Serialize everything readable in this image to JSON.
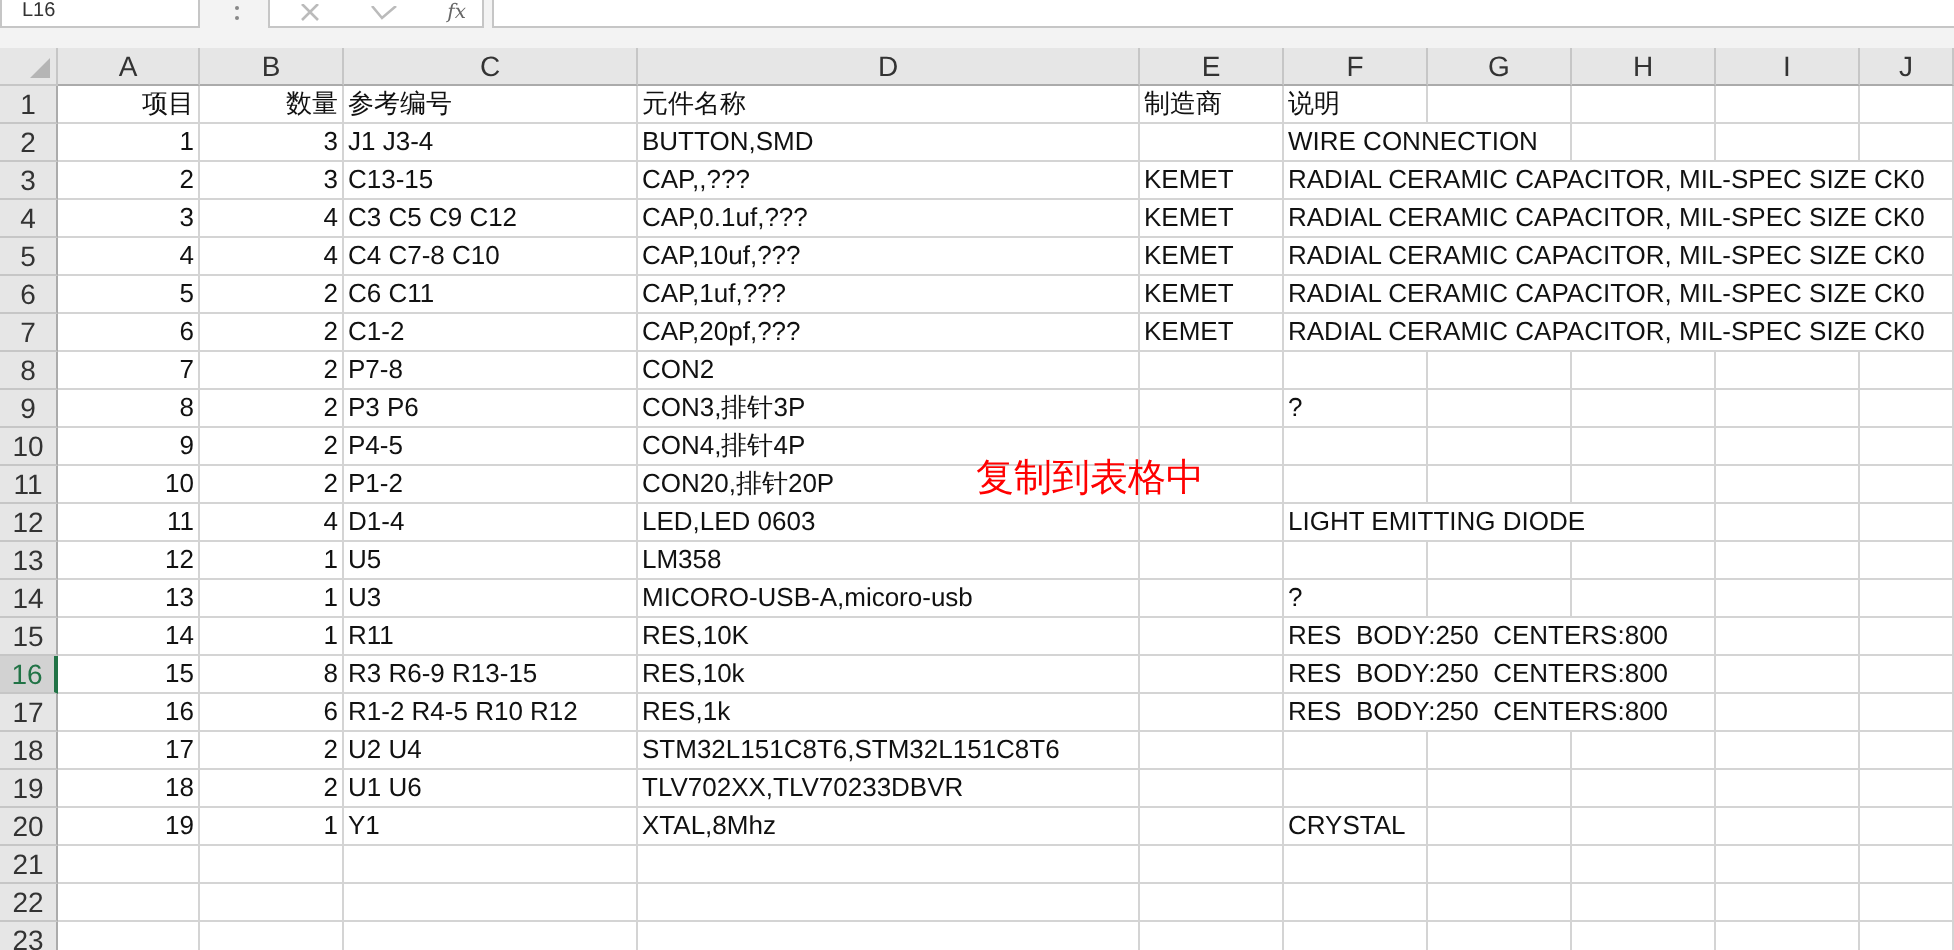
{
  "name_box": "L16",
  "formula_label": "fx",
  "columns": [
    "A",
    "B",
    "C",
    "D",
    "E",
    "F",
    "G",
    "H",
    "I",
    "J"
  ],
  "rows": [
    {
      "number": "1",
      "selected": false,
      "cells": {
        "A": "项目",
        "B": "数量",
        "C": "参考编号",
        "D": "元件名称",
        "E": "制造商",
        "F": "说明"
      }
    },
    {
      "number": "2",
      "selected": false,
      "cells": {
        "A": "1",
        "B": "3",
        "C": "J1 J3-4",
        "D": "BUTTON,SMD",
        "F": "WIRE CONNECTION"
      }
    },
    {
      "number": "3",
      "selected": false,
      "cells": {
        "A": "2",
        "B": "3",
        "C": "C13-15",
        "D": "CAP,,???",
        "E": "KEMET",
        "F": "RADIAL CERAMIC CAPACITOR, MIL-SPEC SIZE CK0"
      }
    },
    {
      "number": "4",
      "selected": false,
      "cells": {
        "A": "3",
        "B": "4",
        "C": "C3 C5 C9 C12",
        "D": "CAP,0.1uf,???",
        "E": "KEMET",
        "F": "RADIAL CERAMIC CAPACITOR, MIL-SPEC SIZE CK0"
      }
    },
    {
      "number": "5",
      "selected": false,
      "cells": {
        "A": "4",
        "B": "4",
        "C": "C4 C7-8 C10",
        "D": "CAP,10uf,???",
        "E": "KEMET",
        "F": "RADIAL CERAMIC CAPACITOR, MIL-SPEC SIZE CK0"
      }
    },
    {
      "number": "6",
      "selected": false,
      "cells": {
        "A": "5",
        "B": "2",
        "C": "C6 C11",
        "D": "CAP,1uf,???",
        "E": "KEMET",
        "F": "RADIAL CERAMIC CAPACITOR, MIL-SPEC SIZE CK0"
      }
    },
    {
      "number": "7",
      "selected": false,
      "cells": {
        "A": "6",
        "B": "2",
        "C": "C1-2",
        "D": "CAP,20pf,???",
        "E": "KEMET",
        "F": "RADIAL CERAMIC CAPACITOR, MIL-SPEC SIZE CK0"
      }
    },
    {
      "number": "8",
      "selected": false,
      "cells": {
        "A": "7",
        "B": "2",
        "C": "P7-8",
        "D": "CON2"
      }
    },
    {
      "number": "9",
      "selected": false,
      "cells": {
        "A": "8",
        "B": "2",
        "C": "P3 P6",
        "D": "CON3,排针3P",
        "F": "?"
      }
    },
    {
      "number": "10",
      "selected": false,
      "cells": {
        "A": "9",
        "B": "2",
        "C": "P4-5",
        "D": "CON4,排针4P"
      }
    },
    {
      "number": "11",
      "selected": false,
      "cells": {
        "A": "10",
        "B": "2",
        "C": "P1-2",
        "D": "CON20,排针20P"
      }
    },
    {
      "number": "12",
      "selected": false,
      "cells": {
        "A": "11",
        "B": "4",
        "C": "D1-4",
        "D": "LED,LED 0603",
        "F": "LIGHT EMITTING DIODE"
      }
    },
    {
      "number": "13",
      "selected": false,
      "cells": {
        "A": "12",
        "B": "1",
        "C": "U5",
        "D": "LM358"
      }
    },
    {
      "number": "14",
      "selected": false,
      "cells": {
        "A": "13",
        "B": "1",
        "C": "U3",
        "D": "MICORO-USB-A,micoro-usb",
        "F": "?"
      }
    },
    {
      "number": "15",
      "selected": false,
      "cells": {
        "A": "14",
        "B": "1",
        "C": "R11",
        "D": "RES,10K",
        "F": "RES  BODY:250  CENTERS:800"
      }
    },
    {
      "number": "16",
      "selected": true,
      "cells": {
        "A": "15",
        "B": "8",
        "C": "R3 R6-9 R13-15",
        "D": "RES,10k",
        "F": "RES  BODY:250  CENTERS:800"
      }
    },
    {
      "number": "17",
      "selected": false,
      "cells": {
        "A": "16",
        "B": "6",
        "C": "R1-2 R4-5 R10 R12",
        "D": "RES,1k",
        "F": "RES  BODY:250  CENTERS:800"
      }
    },
    {
      "number": "18",
      "selected": false,
      "cells": {
        "A": "17",
        "B": "2",
        "C": "U2 U4",
        "D": "STM32L151C8T6,STM32L151C8T6"
      }
    },
    {
      "number": "19",
      "selected": false,
      "cells": {
        "A": "18",
        "B": "2",
        "C": "U1 U6",
        "D": "TLV702XX,TLV70233DBVR"
      }
    },
    {
      "number": "20",
      "selected": false,
      "cells": {
        "A": "19",
        "B": "1",
        "C": "Y1",
        "D": "XTAL,8Mhz",
        "F": "CRYSTAL"
      }
    },
    {
      "number": "21",
      "selected": false,
      "cells": {}
    },
    {
      "number": "22",
      "selected": false,
      "cells": {}
    },
    {
      "number": "23",
      "selected": false,
      "cells": {}
    }
  ],
  "overlay_text": "复制到表格中"
}
